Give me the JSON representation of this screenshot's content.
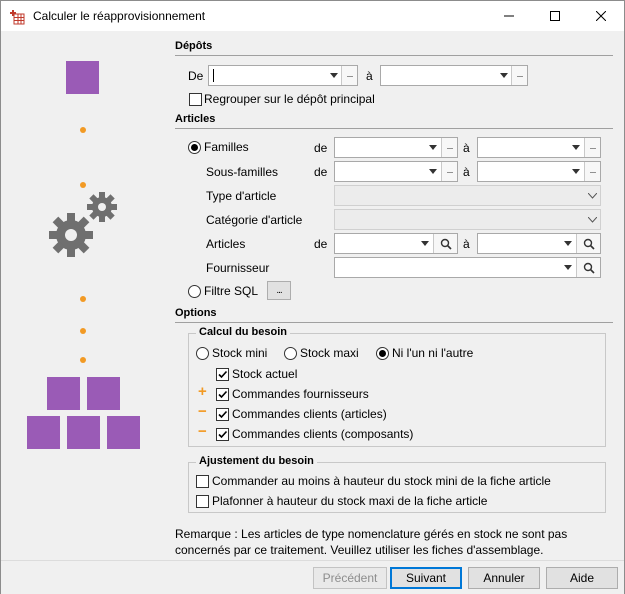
{
  "window": {
    "title": "Calculer le réapprovisionnement"
  },
  "depots": {
    "section_title": "Dépôts",
    "de_label": "De",
    "a_label": "à",
    "regroup_label": "Regrouper sur le dépôt principal",
    "regroup_checked": false
  },
  "articles": {
    "section_title": "Articles",
    "familles_label": "Familles",
    "de_label": "de",
    "a_label": "à",
    "sous_familles_label": "Sous-familles",
    "type_article_label": "Type d'article",
    "categorie_article_label": "Catégorie d'article",
    "articles_label": "Articles",
    "fournisseur_label": "Fournisseur",
    "filtre_sql_label": "Filtre SQL",
    "filtre_sql_button": "...",
    "selected_mode": "Familles"
  },
  "options": {
    "section_title": "Options",
    "calcul_title": "Calcul du besoin",
    "stock_mini_label": "Stock mini",
    "stock_maxi_label": "Stock maxi",
    "ni_label": "Ni l'un ni l'autre",
    "stock_choice": "Ni l'un ni l'autre",
    "stock_actuel_label": "Stock actuel",
    "cmd_fournisseurs_label": "Commandes fournisseurs",
    "cmd_clients_articles_label": "Commandes clients (articles)",
    "cmd_clients_composants_label": "Commandes clients (composants)",
    "plus_sign": "+",
    "minus_sign": "−",
    "ajustement_title": "Ajustement du besoin",
    "commander_label": "Commander au moins à hauteur du stock mini de la fiche article",
    "plafonner_label": "Plafonner à hauteur du stock maxi de la fiche article"
  },
  "note": "Remarque : Les articles de type nomenclature gérés en stock ne sont pas concernés par ce traitement. Veuillez utiliser les fiches d'assemblage.",
  "buttons": {
    "precedent": "Précédent",
    "suivant": "Suivant",
    "annuler": "Annuler",
    "aide": "Aide"
  },
  "colors": {
    "accent_purple": "#9a5bb6",
    "accent_orange": "#f29a24",
    "focus_blue": "#0078d7"
  }
}
